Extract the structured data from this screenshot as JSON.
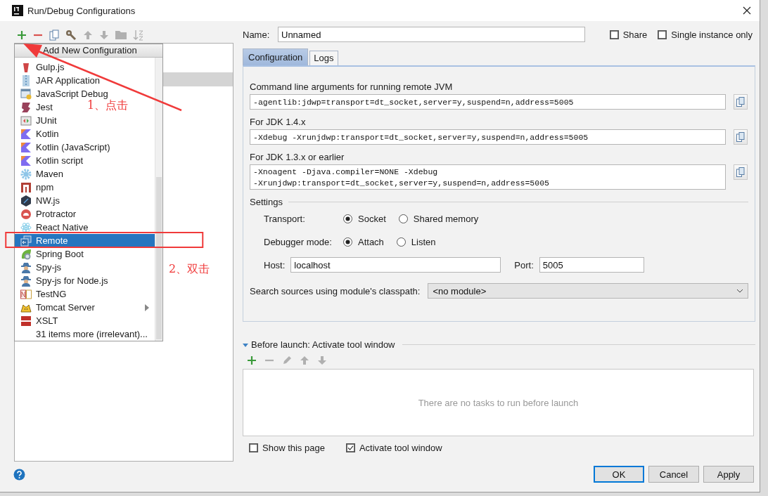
{
  "window": {
    "title": "Run/Debug Configurations"
  },
  "toolbar": [
    {
      "kind": "add",
      "disabled": false
    },
    {
      "kind": "remove",
      "disabled": false
    },
    {
      "kind": "copy",
      "disabled": false
    },
    {
      "kind": "wrench",
      "disabled": false
    },
    {
      "kind": "up",
      "disabled": true
    },
    {
      "kind": "down",
      "disabled": true
    },
    {
      "kind": "folder",
      "disabled": true
    },
    {
      "kind": "sort",
      "disabled": true
    }
  ],
  "popup": {
    "title": "Add New Configuration",
    "items": [
      {
        "label": "Gulp.js",
        "kind": "gulp",
        "selected": false,
        "submenu": false
      },
      {
        "label": "JAR Application",
        "kind": "jar",
        "selected": false,
        "submenu": false
      },
      {
        "label": "JavaScript Debug",
        "kind": "jsdebug",
        "selected": false,
        "submenu": false
      },
      {
        "label": "Jest",
        "kind": "jest",
        "selected": false,
        "submenu": false
      },
      {
        "label": "JUnit",
        "kind": "junit",
        "selected": false,
        "submenu": false
      },
      {
        "label": "Kotlin",
        "kind": "kotlin",
        "selected": false,
        "submenu": false
      },
      {
        "label": "Kotlin (JavaScript)",
        "kind": "kotlin",
        "selected": false,
        "submenu": false
      },
      {
        "label": "Kotlin script",
        "kind": "kotlin",
        "selected": false,
        "submenu": false
      },
      {
        "label": "Maven",
        "kind": "maven",
        "selected": false,
        "submenu": false
      },
      {
        "label": "npm",
        "kind": "npm",
        "selected": false,
        "submenu": false
      },
      {
        "label": "NW.js",
        "kind": "nwjs",
        "selected": false,
        "submenu": false
      },
      {
        "label": "Protractor",
        "kind": "protractor",
        "selected": false,
        "submenu": false
      },
      {
        "label": "React Native",
        "kind": "react",
        "selected": false,
        "submenu": false
      },
      {
        "label": "Remote",
        "kind": "remote",
        "selected": true,
        "submenu": false
      },
      {
        "label": "Spring Boot",
        "kind": "spring",
        "selected": false,
        "submenu": false
      },
      {
        "label": "Spy-js",
        "kind": "spy",
        "selected": false,
        "submenu": false
      },
      {
        "label": "Spy-js for Node.js",
        "kind": "spy",
        "selected": false,
        "submenu": false
      },
      {
        "label": "TestNG",
        "kind": "testng",
        "selected": false,
        "submenu": false
      },
      {
        "label": "Tomcat Server",
        "kind": "tomcat",
        "selected": false,
        "submenu": true
      },
      {
        "label": "XSLT",
        "kind": "xslt",
        "selected": false,
        "submenu": false
      },
      {
        "label": "31 items more (irrelevant)...",
        "kind": "more",
        "selected": false,
        "submenu": false
      }
    ]
  },
  "name": {
    "label": "Name:",
    "value": "Unnamed"
  },
  "options": [
    {
      "label": "Share",
      "checked": false
    },
    {
      "label": "Single instance only",
      "checked": false
    }
  ],
  "tabs": [
    {
      "label": "Configuration",
      "selected": true
    },
    {
      "label": "Logs",
      "selected": false
    }
  ],
  "arguments": [
    {
      "label": "Command line arguments for running remote JVM",
      "lines": [
        "-agentlib:jdwp=transport=dt_socket,server=y,suspend=n,address=5005"
      ]
    },
    {
      "label": "For JDK 1.4.x",
      "lines": [
        "-Xdebug -Xrunjdwp:transport=dt_socket,server=y,suspend=n,address=5005"
      ]
    },
    {
      "label": "For JDK 1.3.x or earlier",
      "lines": [
        "-Xnoagent -Djava.compiler=NONE -Xdebug",
        "-Xrunjdwp:transport=dt_socket,server=y,suspend=n,address=5005"
      ]
    }
  ],
  "settings": {
    "title": "Settings",
    "radio_groups": [
      {
        "label": "Transport:",
        "options": [
          {
            "label": "Socket",
            "selected": true
          },
          {
            "label": "Shared memory",
            "selected": false
          }
        ]
      },
      {
        "label": "Debugger mode:",
        "options": [
          {
            "label": "Attach",
            "selected": true
          },
          {
            "label": "Listen",
            "selected": false
          }
        ]
      }
    ],
    "host": {
      "label": "Host:",
      "value": "localhost"
    },
    "port": {
      "label": "Port:",
      "value": "5005"
    },
    "module": {
      "label": "Search sources using module's classpath:",
      "value": "<no module>"
    }
  },
  "before_launch": {
    "title": "Before launch: Activate tool window",
    "expanded": true,
    "tools": [
      {
        "kind": "add",
        "disabled": false
      },
      {
        "kind": "remove",
        "disabled": true
      },
      {
        "kind": "edit",
        "disabled": true
      },
      {
        "kind": "up",
        "disabled": true
      },
      {
        "kind": "down",
        "disabled": true
      }
    ],
    "empty_text": "There are no tasks to run before launch",
    "checkboxes": [
      {
        "label": "Show this page",
        "checked": false
      },
      {
        "label": "Activate tool window",
        "checked": true
      }
    ]
  },
  "buttons": [
    {
      "label": "OK",
      "default": true
    },
    {
      "label": "Cancel",
      "default": false
    },
    {
      "label": "Apply",
      "default": false
    }
  ],
  "annotations": [
    {
      "text": "1、点击"
    },
    {
      "text": "2、双击"
    }
  ]
}
